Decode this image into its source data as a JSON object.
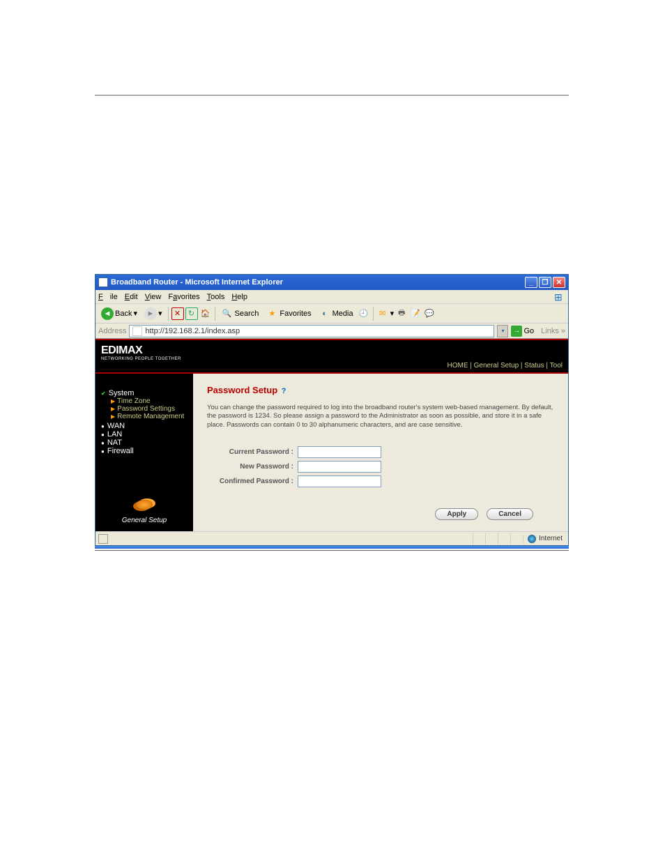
{
  "window": {
    "title": "Broadband Router - Microsoft Internet Explorer",
    "min_label": "_",
    "max_label": "❐",
    "close_label": "✕"
  },
  "menu": {
    "file": "File",
    "edit": "Edit",
    "view": "View",
    "favorites": "Favorites",
    "tools": "Tools",
    "help": "Help"
  },
  "toolbar": {
    "back": "Back",
    "search": "Search",
    "favorites": "Favorites",
    "media": "Media"
  },
  "address": {
    "label": "Address",
    "url": "http://192.168.2.1/index.asp",
    "go": "Go",
    "links": "Links »"
  },
  "brand": {
    "name": "EDIMAX",
    "tagline": "NETWORKING PEOPLE TOGETHER"
  },
  "topnav": {
    "home": "HOME",
    "general": "General Setup",
    "status": "Status",
    "tool": "Tool"
  },
  "sidebar": {
    "system": "System",
    "timezone": "Time Zone",
    "password": "Password Settings",
    "remote": "Remote Management",
    "wan": "WAN",
    "lan": "LAN",
    "nat": "NAT",
    "firewall": "Firewall",
    "caption": "General Setup"
  },
  "page": {
    "title": "Password Setup",
    "desc": "You can change the password required to log into the broadband router's system web-based management. By default, the password is 1234. So please assign a password to the Administrator as soon as possible, and store it in a safe place. Passwords can contain 0 to 30 alphanumeric characters, and are case sensitive.",
    "current": "Current Password :",
    "new": "New Password :",
    "confirm": "Confirmed Password :",
    "apply": "Apply",
    "cancel": "Cancel"
  },
  "status": {
    "zone": "Internet"
  }
}
